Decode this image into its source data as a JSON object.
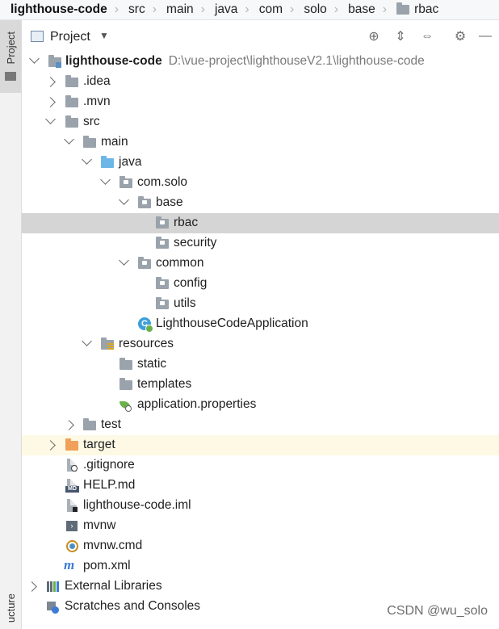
{
  "breadcrumb": [
    {
      "label": "lighthouse-code",
      "bold": true
    },
    {
      "label": "src"
    },
    {
      "label": "main"
    },
    {
      "label": "java"
    },
    {
      "label": "com"
    },
    {
      "label": "solo"
    },
    {
      "label": "base"
    },
    {
      "label": "rbac",
      "icon": true
    }
  ],
  "strip": {
    "project_tab": "Project",
    "structure_tab": "ucture"
  },
  "panel": {
    "title": "Project",
    "caret": "▼"
  },
  "toolbar": {
    "locate_icon": "⊕",
    "expand_icon": "⇕",
    "collapse_icon": "⇔",
    "settings_icon": "⚙",
    "hide_icon": "—"
  },
  "tree": [
    {
      "label": "lighthouse-code",
      "path": "D:\\vue-project\\lighthouseV2.1\\lighthouse-code",
      "bold": true
    },
    {
      "label": ".idea"
    },
    {
      "label": ".mvn"
    },
    {
      "label": "src"
    },
    {
      "label": "main"
    },
    {
      "label": "java"
    },
    {
      "label": "com.solo"
    },
    {
      "label": "base"
    },
    {
      "label": "rbac"
    },
    {
      "label": "security"
    },
    {
      "label": "common"
    },
    {
      "label": "config"
    },
    {
      "label": "utils"
    },
    {
      "label": "LighthouseCodeApplication"
    },
    {
      "label": "resources"
    },
    {
      "label": "static"
    },
    {
      "label": "templates"
    },
    {
      "label": "application.properties"
    },
    {
      "label": "test"
    },
    {
      "label": "target"
    },
    {
      "label": ".gitignore"
    },
    {
      "label": "HELP.md"
    },
    {
      "label": "lighthouse-code.iml"
    },
    {
      "label": "mvnw"
    },
    {
      "label": "mvnw.cmd"
    },
    {
      "label": "pom.xml"
    },
    {
      "label": "External Libraries"
    },
    {
      "label": "Scratches and Consoles"
    }
  ],
  "colors": {
    "selected": "#d5d5d5",
    "excluded_highlight": "#fdf9e4",
    "java_folder": "#6cb7e8",
    "target_folder": "#f0a05a"
  },
  "watermark": "CSDN @wu_solo"
}
